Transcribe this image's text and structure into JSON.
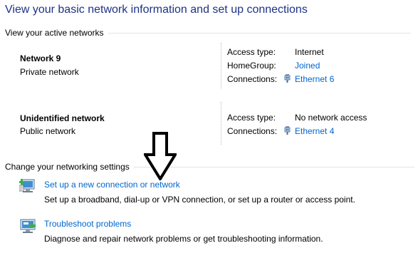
{
  "header": {
    "title": "View your basic network information and set up connections"
  },
  "active_networks": {
    "section_label": "View your active networks",
    "networks": [
      {
        "name": "Network  9",
        "type": "Private network",
        "access_type_label": "Access type:",
        "access_type_value": "Internet",
        "homegroup_label": "HomeGroup:",
        "homegroup_value": "Joined",
        "connections_label": "Connections:",
        "connections_value": "Ethernet 6"
      },
      {
        "name": "Unidentified network",
        "type": "Public network",
        "access_type_label": "Access type:",
        "access_type_value": "No network access",
        "connections_label": "Connections:",
        "connections_value": "Ethernet 4"
      }
    ]
  },
  "settings": {
    "section_label": "Change your networking settings",
    "tasks": [
      {
        "link": "Set up a new connection or network",
        "description": "Set up a broadband, dial-up or VPN connection, or set up a router or access point.",
        "icon": "new-connection-icon"
      },
      {
        "link": "Troubleshoot problems",
        "description": "Diagnose and repair network problems or get troubleshooting information.",
        "icon": "troubleshoot-icon"
      }
    ]
  },
  "annotation": {
    "icon": "down-arrow-annotation"
  },
  "colors": {
    "title": "#1e3287",
    "link": "#0066cc",
    "rule": "#e3e3e3"
  }
}
